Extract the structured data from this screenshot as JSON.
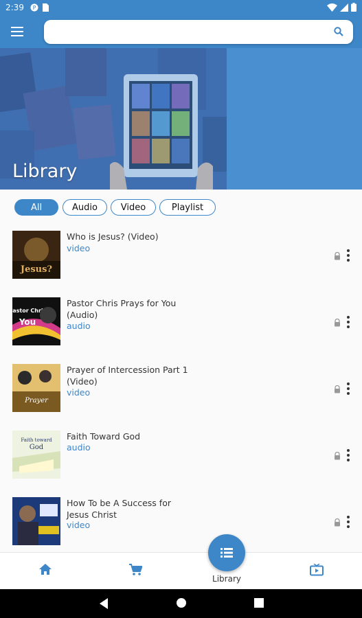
{
  "status_bar": {
    "time": "2:39",
    "icons": [
      "notification-icon",
      "sim-icon",
      "wifi-icon",
      "signal-icon",
      "battery-icon"
    ]
  },
  "appbar": {
    "menu_icon": "hamburger-icon",
    "search": {
      "placeholder": "",
      "value": "",
      "icon": "search-icon"
    }
  },
  "hero": {
    "title": "Library"
  },
  "filters": [
    {
      "label": "All",
      "active": true
    },
    {
      "label": "Audio",
      "active": false
    },
    {
      "label": "Video",
      "active": false
    },
    {
      "label": "Playlist",
      "active": false
    }
  ],
  "items": [
    {
      "title": "Who is Jesus? (Video)",
      "type": "video"
    },
    {
      "title": "Pastor Chris Prays for You (Audio)",
      "type": "audio"
    },
    {
      "title": "Prayer of Intercession Part 1 (Video)",
      "type": "video"
    },
    {
      "title": "Faith Toward God",
      "type": "audio"
    },
    {
      "title": "How To be A Success for Jesus Christ",
      "type": "video"
    }
  ],
  "bottom_nav": {
    "home_icon": "home-icon",
    "cart_icon": "cart-icon",
    "library": {
      "label": "Library",
      "icon": "library-icon"
    },
    "tv_icon": "tv-icon"
  },
  "colors": {
    "accent": "#3d86c8",
    "background": "#fafafa"
  }
}
